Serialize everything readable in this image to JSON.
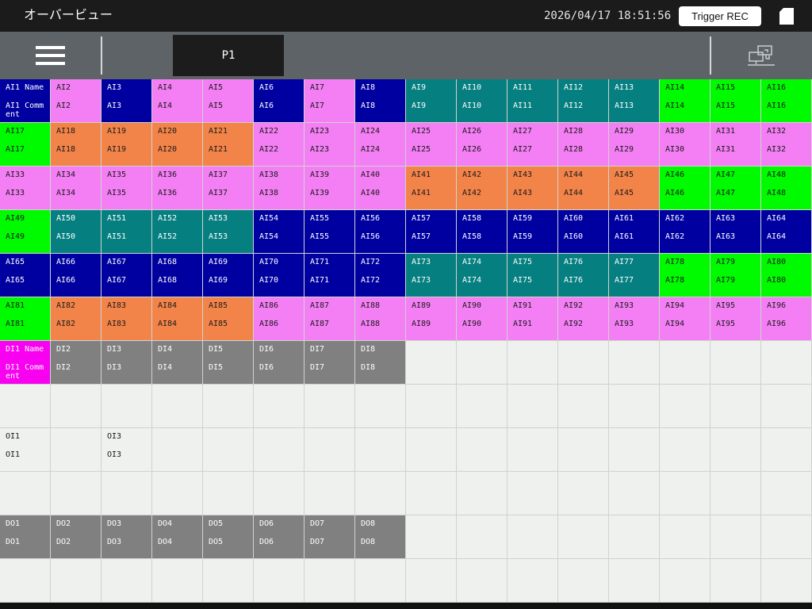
{
  "header": {
    "title": "オーバービュー",
    "datetime": "2026/04/17 18:51:56",
    "trigger_label": "Trigger REC"
  },
  "toolbar": {
    "page_tab": "P1"
  },
  "icons": {
    "menu": "hamburger-icon",
    "storage": "sd-card-icon",
    "network": "network-icon"
  },
  "palette": {
    "navy": {
      "bg": "#0000a0",
      "fg": "#ffffff"
    },
    "pink": {
      "bg": "#f47ff4",
      "fg": "#1a1a1a"
    },
    "teal": {
      "bg": "#067f80",
      "fg": "#ffffff"
    },
    "green": {
      "bg": "#00fa00",
      "fg": "#1a1a1a"
    },
    "orange": {
      "bg": "#f38449",
      "fg": "#1a1a1a"
    },
    "gray": {
      "bg": "#808080",
      "fg": "#ffffff"
    },
    "magenta": {
      "bg": "#f800f0",
      "fg": "#ffffff"
    },
    "empty": {
      "bg": "#eef1ee",
      "fg": "#1a1a1a"
    }
  },
  "grid": {
    "rows": [
      [
        {
          "name": "AI1 Name",
          "comment": "AI1 Comment",
          "color": "navy"
        },
        {
          "name": "AI2",
          "comment": "AI2",
          "color": "pink"
        },
        {
          "name": "AI3",
          "comment": "AI3",
          "color": "navy"
        },
        {
          "name": "AI4",
          "comment": "AI4",
          "color": "pink"
        },
        {
          "name": "AI5",
          "comment": "AI5",
          "color": "pink"
        },
        {
          "name": "AI6",
          "comment": "AI6",
          "color": "navy"
        },
        {
          "name": "AI7",
          "comment": "AI7",
          "color": "pink"
        },
        {
          "name": "AI8",
          "comment": "AI8",
          "color": "navy"
        },
        {
          "name": "AI9",
          "comment": "AI9",
          "color": "teal"
        },
        {
          "name": "AI10",
          "comment": "AI10",
          "color": "teal"
        },
        {
          "name": "AI11",
          "comment": "AI11",
          "color": "teal"
        },
        {
          "name": "AI12",
          "comment": "AI12",
          "color": "teal"
        },
        {
          "name": "AI13",
          "comment": "AI13",
          "color": "teal"
        },
        {
          "name": "AI14",
          "comment": "AI14",
          "color": "green"
        },
        {
          "name": "AI15",
          "comment": "AI15",
          "color": "green"
        },
        {
          "name": "AI16",
          "comment": "AI16",
          "color": "green"
        }
      ],
      [
        {
          "name": "AI17",
          "comment": "AI17",
          "color": "green"
        },
        {
          "name": "AI18",
          "comment": "AI18",
          "color": "orange"
        },
        {
          "name": "AI19",
          "comment": "AI19",
          "color": "orange"
        },
        {
          "name": "AI20",
          "comment": "AI20",
          "color": "orange"
        },
        {
          "name": "AI21",
          "comment": "AI21",
          "color": "orange"
        },
        {
          "name": "AI22",
          "comment": "AI22",
          "color": "pink"
        },
        {
          "name": "AI23",
          "comment": "AI23",
          "color": "pink"
        },
        {
          "name": "AI24",
          "comment": "AI24",
          "color": "pink"
        },
        {
          "name": "AI25",
          "comment": "AI25",
          "color": "pink"
        },
        {
          "name": "AI26",
          "comment": "AI26",
          "color": "pink"
        },
        {
          "name": "AI27",
          "comment": "AI27",
          "color": "pink"
        },
        {
          "name": "AI28",
          "comment": "AI28",
          "color": "pink"
        },
        {
          "name": "AI29",
          "comment": "AI29",
          "color": "pink"
        },
        {
          "name": "AI30",
          "comment": "AI30",
          "color": "pink"
        },
        {
          "name": "AI31",
          "comment": "AI31",
          "color": "pink"
        },
        {
          "name": "AI32",
          "comment": "AI32",
          "color": "pink"
        }
      ],
      [
        {
          "name": "AI33",
          "comment": "AI33",
          "color": "pink"
        },
        {
          "name": "AI34",
          "comment": "AI34",
          "color": "pink"
        },
        {
          "name": "AI35",
          "comment": "AI35",
          "color": "pink"
        },
        {
          "name": "AI36",
          "comment": "AI36",
          "color": "pink"
        },
        {
          "name": "AI37",
          "comment": "AI37",
          "color": "pink"
        },
        {
          "name": "AI38",
          "comment": "AI38",
          "color": "pink"
        },
        {
          "name": "AI39",
          "comment": "AI39",
          "color": "pink"
        },
        {
          "name": "AI40",
          "comment": "AI40",
          "color": "pink"
        },
        {
          "name": "AI41",
          "comment": "AI41",
          "color": "orange"
        },
        {
          "name": "AI42",
          "comment": "AI42",
          "color": "orange"
        },
        {
          "name": "AI43",
          "comment": "AI43",
          "color": "orange"
        },
        {
          "name": "AI44",
          "comment": "AI44",
          "color": "orange"
        },
        {
          "name": "AI45",
          "comment": "AI45",
          "color": "orange"
        },
        {
          "name": "AI46",
          "comment": "AI46",
          "color": "green"
        },
        {
          "name": "AI47",
          "comment": "AI47",
          "color": "green"
        },
        {
          "name": "AI48",
          "comment": "AI48",
          "color": "green"
        }
      ],
      [
        {
          "name": "AI49",
          "comment": "AI49",
          "color": "green"
        },
        {
          "name": "AI50",
          "comment": "AI50",
          "color": "teal"
        },
        {
          "name": "AI51",
          "comment": "AI51",
          "color": "teal"
        },
        {
          "name": "AI52",
          "comment": "AI52",
          "color": "teal"
        },
        {
          "name": "AI53",
          "comment": "AI53",
          "color": "teal"
        },
        {
          "name": "AI54",
          "comment": "AI54",
          "color": "navy"
        },
        {
          "name": "AI55",
          "comment": "AI55",
          "color": "navy"
        },
        {
          "name": "AI56",
          "comment": "AI56",
          "color": "navy"
        },
        {
          "name": "AI57",
          "comment": "AI57",
          "color": "navy"
        },
        {
          "name": "AI58",
          "comment": "AI58",
          "color": "navy"
        },
        {
          "name": "AI59",
          "comment": "AI59",
          "color": "navy"
        },
        {
          "name": "AI60",
          "comment": "AI60",
          "color": "navy"
        },
        {
          "name": "AI61",
          "comment": "AI61",
          "color": "navy"
        },
        {
          "name": "AI62",
          "comment": "AI62",
          "color": "navy"
        },
        {
          "name": "AI63",
          "comment": "AI63",
          "color": "navy"
        },
        {
          "name": "AI64",
          "comment": "AI64",
          "color": "navy"
        }
      ],
      [
        {
          "name": "AI65",
          "comment": "AI65",
          "color": "navy"
        },
        {
          "name": "AI66",
          "comment": "AI66",
          "color": "navy"
        },
        {
          "name": "AI67",
          "comment": "AI67",
          "color": "navy"
        },
        {
          "name": "AI68",
          "comment": "AI68",
          "color": "navy"
        },
        {
          "name": "AI69",
          "comment": "AI69",
          "color": "navy"
        },
        {
          "name": "AI70",
          "comment": "AI70",
          "color": "navy"
        },
        {
          "name": "AI71",
          "comment": "AI71",
          "color": "navy"
        },
        {
          "name": "AI72",
          "comment": "AI72",
          "color": "navy"
        },
        {
          "name": "AI73",
          "comment": "AI73",
          "color": "teal"
        },
        {
          "name": "AI74",
          "comment": "AI74",
          "color": "teal"
        },
        {
          "name": "AI75",
          "comment": "AI75",
          "color": "teal"
        },
        {
          "name": "AI76",
          "comment": "AI76",
          "color": "teal"
        },
        {
          "name": "AI77",
          "comment": "AI77",
          "color": "teal"
        },
        {
          "name": "AI78",
          "comment": "AI78",
          "color": "green"
        },
        {
          "name": "AI79",
          "comment": "AI79",
          "color": "green"
        },
        {
          "name": "AI80",
          "comment": "AI80",
          "color": "green"
        }
      ],
      [
        {
          "name": "AI81",
          "comment": "AI81",
          "color": "green"
        },
        {
          "name": "AI82",
          "comment": "AI82",
          "color": "orange"
        },
        {
          "name": "AI83",
          "comment": "AI83",
          "color": "orange"
        },
        {
          "name": "AI84",
          "comment": "AI84",
          "color": "orange"
        },
        {
          "name": "AI85",
          "comment": "AI85",
          "color": "orange"
        },
        {
          "name": "AI86",
          "comment": "AI86",
          "color": "pink"
        },
        {
          "name": "AI87",
          "comment": "AI87",
          "color": "pink"
        },
        {
          "name": "AI88",
          "comment": "AI88",
          "color": "pink"
        },
        {
          "name": "AI89",
          "comment": "AI89",
          "color": "pink"
        },
        {
          "name": "AI90",
          "comment": "AI90",
          "color": "pink"
        },
        {
          "name": "AI91",
          "comment": "AI91",
          "color": "pink"
        },
        {
          "name": "AI92",
          "comment": "AI92",
          "color": "pink"
        },
        {
          "name": "AI93",
          "comment": "AI93",
          "color": "pink"
        },
        {
          "name": "AI94",
          "comment": "AI94",
          "color": "pink"
        },
        {
          "name": "AI95",
          "comment": "AI95",
          "color": "pink"
        },
        {
          "name": "AI96",
          "comment": "AI96",
          "color": "pink"
        }
      ],
      [
        {
          "name": "DI1 Name",
          "comment": "DI1 Comment",
          "color": "magenta"
        },
        {
          "name": "DI2",
          "comment": "DI2",
          "color": "gray"
        },
        {
          "name": "DI3",
          "comment": "DI3",
          "color": "gray"
        },
        {
          "name": "DI4",
          "comment": "DI4",
          "color": "gray"
        },
        {
          "name": "DI5",
          "comment": "DI5",
          "color": "gray"
        },
        {
          "name": "DI6",
          "comment": "DI6",
          "color": "gray"
        },
        {
          "name": "DI7",
          "comment": "DI7",
          "color": "gray"
        },
        {
          "name": "DI8",
          "comment": "DI8",
          "color": "gray"
        },
        null,
        null,
        null,
        null,
        null,
        null,
        null,
        null
      ],
      [
        null,
        null,
        null,
        null,
        null,
        null,
        null,
        null,
        null,
        null,
        null,
        null,
        null,
        null,
        null,
        null
      ],
      [
        {
          "name": "OI1",
          "comment": "OI1",
          "color": "empty"
        },
        null,
        {
          "name": "OI3",
          "comment": "OI3",
          "color": "empty"
        },
        null,
        null,
        null,
        null,
        null,
        null,
        null,
        null,
        null,
        null,
        null,
        null,
        null
      ],
      [
        null,
        null,
        null,
        null,
        null,
        null,
        null,
        null,
        null,
        null,
        null,
        null,
        null,
        null,
        null,
        null
      ],
      [
        {
          "name": "DO1",
          "comment": "DO1",
          "color": "gray"
        },
        {
          "name": "DO2",
          "comment": "DO2",
          "color": "gray"
        },
        {
          "name": "DO3",
          "comment": "DO3",
          "color": "gray"
        },
        {
          "name": "DO4",
          "comment": "DO4",
          "color": "gray"
        },
        {
          "name": "DO5",
          "comment": "DO5",
          "color": "gray"
        },
        {
          "name": "DO6",
          "comment": "DO6",
          "color": "gray"
        },
        {
          "name": "DO7",
          "comment": "DO7",
          "color": "gray"
        },
        {
          "name": "DO8",
          "comment": "DO8",
          "color": "gray"
        },
        null,
        null,
        null,
        null,
        null,
        null,
        null,
        null
      ],
      [
        null,
        null,
        null,
        null,
        null,
        null,
        null,
        null,
        null,
        null,
        null,
        null,
        null,
        null,
        null,
        null
      ]
    ]
  }
}
